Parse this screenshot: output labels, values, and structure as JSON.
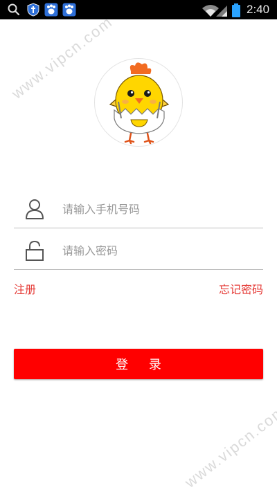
{
  "status_bar": {
    "time": "2:40",
    "icons": [
      "search-icon",
      "shield-icon",
      "paw-icon",
      "paw-icon",
      "wifi-icon",
      "signal-icon",
      "battery-icon"
    ]
  },
  "avatar": {
    "icon": "chick-mascot"
  },
  "form": {
    "phone_placeholder": "请输入手机号码",
    "password_placeholder": "请输入密码",
    "phone_icon": "user-icon",
    "password_icon": "lock-icon"
  },
  "links": {
    "register": "注册",
    "forgot": "忘记密码"
  },
  "login_button": {
    "label": "登 录"
  },
  "watermark": {
    "text": "www.vipcn.com"
  },
  "colors": {
    "accent": "#ff0000",
    "link": "#e53935",
    "status_bar": "#000000",
    "divider": "#bdbdbd"
  }
}
